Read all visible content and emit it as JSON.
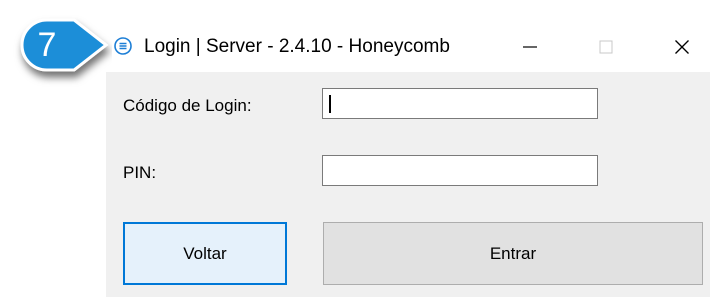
{
  "step_badge": {
    "number": "7",
    "color": "#1e8ed8"
  },
  "window": {
    "title": "Login | Server - 2.4.10 - Honeycomb",
    "icon": "list-circle-icon"
  },
  "title_buttons": {
    "minimize_icon": "minimize-icon",
    "maximize_icon": "maximize-icon",
    "close_icon": "close-icon"
  },
  "form": {
    "login_code_label": "Código de Login:",
    "login_code_value": "",
    "pin_label": "PIN:",
    "pin_value": ""
  },
  "buttons": {
    "back_label": "Voltar",
    "enter_label": "Entrar"
  },
  "colors": {
    "accent": "#0078d7",
    "window_bg": "#f0f0f0"
  }
}
